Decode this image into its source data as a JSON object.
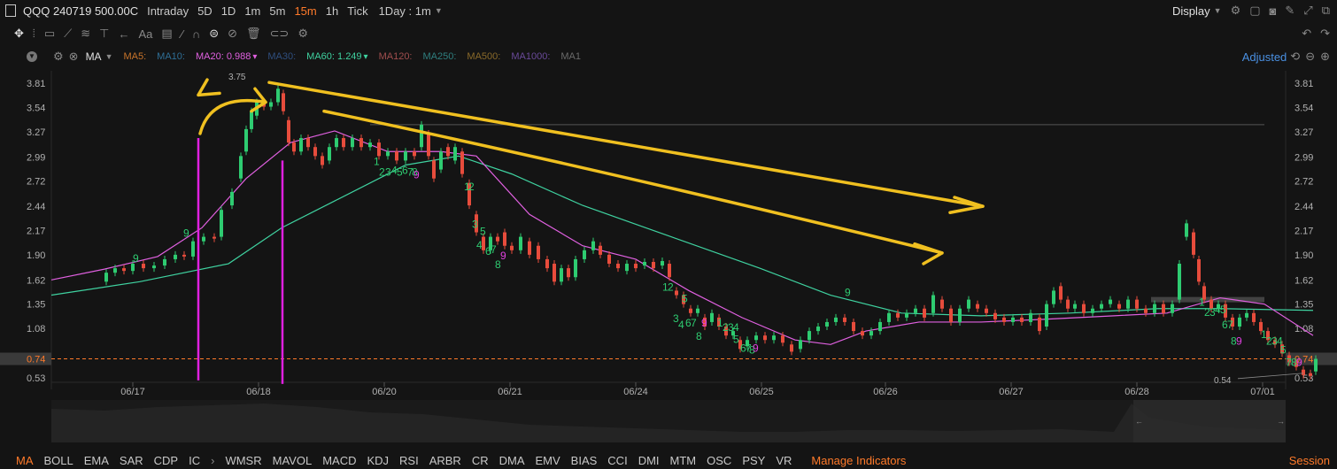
{
  "topbar": {
    "symbol": "QQQ 240719 500.00C",
    "intervals": [
      {
        "label": "Intraday",
        "active": false
      },
      {
        "label": "5D",
        "active": false
      },
      {
        "label": "1D",
        "active": false
      },
      {
        "label": "1m",
        "active": false
      },
      {
        "label": "5m",
        "active": false
      },
      {
        "label": "15m",
        "active": true
      },
      {
        "label": "1h",
        "active": false
      },
      {
        "label": "Tick",
        "active": false
      }
    ],
    "range_select": "1Day : 1m",
    "display_label": "Display"
  },
  "indicator_bar": {
    "type_label": "MA",
    "adjusted_label": "Adjusted",
    "items": [
      {
        "label": "MA5:",
        "color": "#c9742a"
      },
      {
        "label": "MA10:",
        "color": "#2f6f96"
      },
      {
        "label": "MA20: 0.988",
        "color": "#e060e0"
      },
      {
        "label": "MA30:",
        "color": "#2f4f7f"
      },
      {
        "label": "MA60: 1.249",
        "color": "#3fd2a0"
      },
      {
        "label": "MA120:",
        "color": "#a04e4e"
      },
      {
        "label": "MA250:",
        "color": "#2f7f7f"
      },
      {
        "label": "MA500:",
        "color": "#8a6a2a"
      },
      {
        "label": "MA1000:",
        "color": "#6a4a9a"
      },
      {
        "label": "MA1",
        "color": "#6a6a6a"
      }
    ]
  },
  "chart_data": {
    "type": "candlestick",
    "y_ticks": [
      "3.81",
      "3.54",
      "3.27",
      "2.99",
      "2.72",
      "2.44",
      "2.17",
      "1.90",
      "1.62",
      "1.35",
      "1.08",
      "0.74",
      "0.53"
    ],
    "ylim": [
      0.4,
      3.95
    ],
    "x_ticks": [
      "06/17",
      "06/18",
      "06/20",
      "06/21",
      "06/24",
      "06/25",
      "06/26",
      "06/27",
      "06/28",
      "07/01"
    ],
    "current_price": "0.74",
    "high_label": "3.75",
    "low_label": "0.54",
    "colors": {
      "up": "#2ecc71",
      "down": "#e74c3c",
      "ma20": "#e060e0",
      "ma60": "#3fd2a0",
      "price_line": "#ff7a2a",
      "annotation": "#f0c020",
      "vline": "#e020e0"
    },
    "ma20": [
      [
        0,
        1.62
      ],
      [
        60,
        1.74
      ],
      [
        120,
        1.88
      ],
      [
        170,
        2.2
      ],
      [
        220,
        2.75
      ],
      [
        270,
        3.15
      ],
      [
        320,
        3.28
      ],
      [
        380,
        3.05
      ],
      [
        440,
        3.05
      ],
      [
        480,
        3.0
      ],
      [
        540,
        2.35
      ],
      [
        600,
        2.0
      ],
      [
        660,
        1.85
      ],
      [
        720,
        1.5
      ],
      [
        780,
        1.2
      ],
      [
        840,
        0.95
      ],
      [
        880,
        0.9
      ],
      [
        920,
        1.05
      ],
      [
        980,
        1.15
      ],
      [
        1050,
        1.15
      ],
      [
        1120,
        1.18
      ],
      [
        1200,
        1.22
      ],
      [
        1260,
        1.25
      ],
      [
        1320,
        1.42
      ],
      [
        1370,
        1.35
      ],
      [
        1425,
        1.0
      ]
    ],
    "ma60": [
      [
        0,
        1.45
      ],
      [
        100,
        1.6
      ],
      [
        200,
        1.8
      ],
      [
        260,
        2.2
      ],
      [
        320,
        2.5
      ],
      [
        400,
        2.9
      ],
      [
        460,
        3.0
      ],
      [
        520,
        2.8
      ],
      [
        600,
        2.45
      ],
      [
        700,
        2.1
      ],
      [
        800,
        1.75
      ],
      [
        880,
        1.45
      ],
      [
        960,
        1.25
      ],
      [
        1050,
        1.22
      ],
      [
        1150,
        1.25
      ],
      [
        1250,
        1.3
      ],
      [
        1320,
        1.3
      ],
      [
        1425,
        1.28
      ]
    ],
    "candles": [
      [
        62,
        1.6,
        1.7
      ],
      [
        72,
        1.7,
        1.75
      ],
      [
        82,
        1.75,
        1.72
      ],
      [
        92,
        1.72,
        1.8
      ],
      [
        104,
        1.8,
        1.75
      ],
      [
        116,
        1.75,
        1.78
      ],
      [
        128,
        1.78,
        1.85
      ],
      [
        140,
        1.85,
        1.9
      ],
      [
        150,
        1.9,
        1.88
      ],
      [
        160,
        1.88,
        2.05
      ],
      [
        172,
        2.05,
        2.1
      ],
      [
        184,
        2.1,
        2.08
      ],
      [
        192,
        2.1,
        2.4
      ],
      [
        204,
        2.45,
        2.6
      ],
      [
        214,
        2.75,
        3.0
      ],
      [
        220,
        3.05,
        3.3
      ],
      [
        226,
        3.3,
        3.5
      ],
      [
        232,
        3.45,
        3.6
      ],
      [
        240,
        3.6,
        3.55
      ],
      [
        248,
        3.55,
        3.6
      ],
      [
        256,
        3.6,
        3.75
      ],
      [
        262,
        3.7,
        3.5
      ],
      [
        268,
        3.4,
        3.15
      ],
      [
        274,
        3.15,
        3.05
      ],
      [
        282,
        3.05,
        3.2
      ],
      [
        290,
        3.2,
        3.1
      ],
      [
        298,
        3.1,
        3.0
      ],
      [
        306,
        3.0,
        2.9
      ],
      [
        314,
        2.95,
        3.1
      ],
      [
        322,
        3.1,
        3.2
      ],
      [
        330,
        3.2,
        3.1
      ],
      [
        340,
        3.1,
        3.2
      ],
      [
        350,
        3.2,
        3.1
      ],
      [
        360,
        3.1,
        3.15
      ],
      [
        370,
        3.15,
        3.0
      ],
      [
        380,
        3.0,
        3.05
      ],
      [
        390,
        3.05,
        2.95
      ],
      [
        400,
        2.95,
        3.05
      ],
      [
        410,
        3.05,
        3.0
      ],
      [
        418,
        3.1,
        3.35
      ],
      [
        426,
        3.25,
        3.0
      ],
      [
        432,
        2.95,
        2.75
      ],
      [
        440,
        2.85,
        3.05
      ],
      [
        448,
        3.1,
        3.0
      ],
      [
        456,
        2.95,
        3.1
      ],
      [
        464,
        3.05,
        2.8
      ],
      [
        472,
        2.7,
        2.45
      ],
      [
        480,
        2.35,
        2.15
      ],
      [
        488,
        2.1,
        1.95
      ],
      [
        496,
        1.95,
        2.1
      ],
      [
        504,
        2.1,
        2.05
      ],
      [
        512,
        2.15,
        2.0
      ],
      [
        520,
        2.0,
        1.95
      ],
      [
        530,
        1.95,
        2.1
      ],
      [
        540,
        2.05,
        1.9
      ],
      [
        550,
        2.0,
        1.85
      ],
      [
        560,
        1.85,
        1.75
      ],
      [
        568,
        1.8,
        1.6
      ],
      [
        576,
        1.6,
        1.75
      ],
      [
        584,
        1.75,
        1.65
      ],
      [
        592,
        1.65,
        1.85
      ],
      [
        602,
        1.85,
        1.95
      ],
      [
        612,
        1.95,
        2.05
      ],
      [
        620,
        2.0,
        1.9
      ],
      [
        630,
        1.9,
        1.8
      ],
      [
        640,
        1.8,
        1.75
      ],
      [
        650,
        1.72,
        1.8
      ],
      [
        660,
        1.8,
        1.75
      ],
      [
        670,
        1.78,
        1.82
      ],
      [
        680,
        1.82,
        1.75
      ],
      [
        690,
        1.78,
        1.83
      ],
      [
        698,
        1.8,
        1.65
      ],
      [
        706,
        1.5,
        1.45
      ],
      [
        714,
        1.45,
        1.35
      ],
      [
        722,
        1.3,
        1.25
      ],
      [
        730,
        1.25,
        1.3
      ],
      [
        738,
        1.2,
        1.1
      ],
      [
        746,
        1.15,
        1.25
      ],
      [
        754,
        1.2,
        1.1
      ],
      [
        762,
        1.1,
        1.0
      ],
      [
        770,
        1.0,
        1.05
      ],
      [
        778,
        0.95,
        0.85
      ],
      [
        786,
        0.88,
        0.95
      ],
      [
        796,
        0.95,
        1.0
      ],
      [
        806,
        1.0,
        0.95
      ],
      [
        816,
        0.95,
        1.0
      ],
      [
        826,
        1.0,
        0.92
      ],
      [
        836,
        0.9,
        0.82
      ],
      [
        846,
        0.85,
        0.95
      ],
      [
        856,
        0.95,
        1.05
      ],
      [
        866,
        1.05,
        1.1
      ],
      [
        876,
        1.1,
        1.15
      ],
      [
        886,
        1.15,
        1.2
      ],
      [
        896,
        1.2,
        1.15
      ],
      [
        906,
        1.15,
        1.05
      ],
      [
        916,
        1.05,
        1.0
      ],
      [
        926,
        1.0,
        1.05
      ],
      [
        936,
        1.05,
        1.15
      ],
      [
        946,
        1.15,
        1.25
      ],
      [
        956,
        1.25,
        1.2
      ],
      [
        966,
        1.2,
        1.25
      ],
      [
        976,
        1.25,
        1.3
      ],
      [
        986,
        1.3,
        1.2
      ],
      [
        996,
        1.25,
        1.45
      ],
      [
        1006,
        1.4,
        1.3
      ],
      [
        1016,
        1.3,
        1.15
      ],
      [
        1026,
        1.15,
        1.3
      ],
      [
        1036,
        1.3,
        1.4
      ],
      [
        1046,
        1.35,
        1.3
      ],
      [
        1056,
        1.3,
        1.25
      ],
      [
        1066,
        1.25,
        1.18
      ],
      [
        1076,
        1.2,
        1.15
      ],
      [
        1086,
        1.15,
        1.2
      ],
      [
        1096,
        1.2,
        1.15
      ],
      [
        1106,
        1.15,
        1.25
      ],
      [
        1116,
        1.2,
        1.05
      ],
      [
        1124,
        1.1,
        1.35
      ],
      [
        1132,
        1.35,
        1.5
      ],
      [
        1140,
        1.55,
        1.4
      ],
      [
        1148,
        1.4,
        1.3
      ],
      [
        1156,
        1.3,
        1.35
      ],
      [
        1166,
        1.35,
        1.25
      ],
      [
        1176,
        1.25,
        1.3
      ],
      [
        1186,
        1.3,
        1.35
      ],
      [
        1196,
        1.35,
        1.4
      ],
      [
        1206,
        1.35,
        1.3
      ],
      [
        1216,
        1.3,
        1.4
      ],
      [
        1226,
        1.4,
        1.3
      ],
      [
        1236,
        1.3,
        1.25
      ],
      [
        1246,
        1.25,
        1.35
      ],
      [
        1256,
        1.35,
        1.25
      ],
      [
        1266,
        1.25,
        1.35
      ],
      [
        1274,
        1.4,
        1.8
      ],
      [
        1282,
        2.1,
        2.25
      ],
      [
        1290,
        2.15,
        1.9
      ],
      [
        1296,
        1.85,
        1.6
      ],
      [
        1302,
        1.55,
        1.4
      ],
      [
        1310,
        1.4,
        1.3
      ],
      [
        1318,
        1.3,
        1.35
      ],
      [
        1326,
        1.35,
        1.2
      ],
      [
        1334,
        1.2,
        1.1
      ],
      [
        1342,
        1.1,
        1.2
      ],
      [
        1350,
        1.2,
        1.25
      ],
      [
        1358,
        1.25,
        1.15
      ],
      [
        1366,
        1.15,
        1.05
      ],
      [
        1374,
        1.05,
        0.95
      ],
      [
        1382,
        0.95,
        0.9
      ],
      [
        1390,
        0.9,
        0.8
      ],
      [
        1398,
        0.78,
        0.7
      ],
      [
        1406,
        0.7,
        0.65
      ],
      [
        1414,
        0.62,
        0.56
      ],
      [
        1422,
        0.58,
        0.55
      ],
      [
        1428,
        0.6,
        0.74
      ]
    ],
    "seq_labels": [
      {
        "x": 92,
        "y": 1.82,
        "t": "9",
        "c": "#2ecc71"
      },
      {
        "x": 149,
        "y": 2.1,
        "t": "9",
        "c": "#2ecc71"
      },
      {
        "x": 364,
        "y": 2.9,
        "t": "1",
        "c": "#2ecc71"
      },
      {
        "x": 370,
        "y": 2.78,
        "t": "2",
        "c": "#2ecc71"
      },
      {
        "x": 377,
        "y": 2.78,
        "t": "3",
        "c": "#2ecc71"
      },
      {
        "x": 384,
        "y": 2.8,
        "t": "4",
        "c": "#2ecc71"
      },
      {
        "x": 390,
        "y": 2.78,
        "t": "5",
        "c": "#2ecc71"
      },
      {
        "x": 396,
        "y": 2.8,
        "t": "6",
        "c": "#2ecc71"
      },
      {
        "x": 402,
        "y": 2.78,
        "t": "7",
        "c": "#2ecc71"
      },
      {
        "x": 407,
        "y": 2.78,
        "t": "8",
        "c": "#2ecc71"
      },
      {
        "x": 409,
        "y": 2.75,
        "t": "9",
        "c": "#e040e0"
      },
      {
        "x": 466,
        "y": 2.62,
        "t": "1",
        "c": "#2ecc71"
      },
      {
        "x": 471,
        "y": 2.62,
        "t": "2",
        "c": "#2ecc71"
      },
      {
        "x": 475,
        "y": 2.2,
        "t": "3",
        "c": "#2ecc71"
      },
      {
        "x": 484,
        "y": 2.12,
        "t": "5",
        "c": "#2ecc71"
      },
      {
        "x": 480,
        "y": 1.97,
        "t": "4",
        "c": "#2ecc71"
      },
      {
        "x": 490,
        "y": 1.9,
        "t": "6",
        "c": "#2ecc71"
      },
      {
        "x": 496,
        "y": 1.92,
        "t": "7",
        "c": "#2ecc71"
      },
      {
        "x": 507,
        "y": 1.85,
        "t": "9",
        "c": "#e040e0"
      },
      {
        "x": 501,
        "y": 1.75,
        "t": "8",
        "c": "#2ecc71"
      },
      {
        "x": 690,
        "y": 1.5,
        "t": "1",
        "c": "#2ecc71"
      },
      {
        "x": 696,
        "y": 1.5,
        "t": "2",
        "c": "#2ecc71"
      },
      {
        "x": 712,
        "y": 1.37,
        "t": "5",
        "c": "#2ecc71"
      },
      {
        "x": 702,
        "y": 1.15,
        "t": "3",
        "c": "#2ecc71"
      },
      {
        "x": 708,
        "y": 1.08,
        "t": "4",
        "c": "#2ecc71"
      },
      {
        "x": 716,
        "y": 1.1,
        "t": "6",
        "c": "#2ecc71"
      },
      {
        "x": 722,
        "y": 1.1,
        "t": "7",
        "c": "#2ecc71"
      },
      {
        "x": 734,
        "y": 1.1,
        "t": "9",
        "c": "#e040e0"
      },
      {
        "x": 728,
        "y": 0.95,
        "t": "8",
        "c": "#2ecc71"
      },
      {
        "x": 752,
        "y": 1.1,
        "t": "1",
        "c": "#2ecc71"
      },
      {
        "x": 758,
        "y": 1.05,
        "t": "2",
        "c": "#2ecc71"
      },
      {
        "x": 764,
        "y": 1.05,
        "t": "3",
        "c": "#2ecc71"
      },
      {
        "x": 770,
        "y": 1.05,
        "t": "4",
        "c": "#2ecc71"
      },
      {
        "x": 770,
        "y": 0.92,
        "t": "5",
        "c": "#2ecc71"
      },
      {
        "x": 778,
        "y": 0.82,
        "t": "6",
        "c": "#2ecc71"
      },
      {
        "x": 784,
        "y": 0.82,
        "t": "7",
        "c": "#2ecc71"
      },
      {
        "x": 788,
        "y": 0.8,
        "t": "8",
        "c": "#2ecc71"
      },
      {
        "x": 792,
        "y": 0.82,
        "t": "9",
        "c": "#e040e0"
      },
      {
        "x": 896,
        "y": 1.44,
        "t": "9",
        "c": "#2ecc71"
      },
      {
        "x": 1296,
        "y": 1.33,
        "t": "1",
        "c": "#2ecc71"
      },
      {
        "x": 1302,
        "y": 1.22,
        "t": "2",
        "c": "#2ecc71"
      },
      {
        "x": 1308,
        "y": 1.22,
        "t": "3",
        "c": "#2ecc71"
      },
      {
        "x": 1314,
        "y": 1.25,
        "t": "4",
        "c": "#2ecc71"
      },
      {
        "x": 1320,
        "y": 1.25,
        "t": "5",
        "c": "#2ecc71"
      },
      {
        "x": 1322,
        "y": 1.08,
        "t": "6",
        "c": "#2ecc71"
      },
      {
        "x": 1328,
        "y": 1.08,
        "t": "7",
        "c": "#2ecc71"
      },
      {
        "x": 1332,
        "y": 0.9,
        "t": "8",
        "c": "#2ecc71"
      },
      {
        "x": 1338,
        "y": 0.9,
        "t": "9",
        "c": "#e040e0"
      },
      {
        "x": 1366,
        "y": 0.97,
        "t": "1",
        "c": "#2ecc71"
      },
      {
        "x": 1372,
        "y": 0.9,
        "t": "2",
        "c": "#2ecc71"
      },
      {
        "x": 1378,
        "y": 0.9,
        "t": "3",
        "c": "#2ecc71"
      },
      {
        "x": 1384,
        "y": 0.9,
        "t": "4",
        "c": "#2ecc71"
      },
      {
        "x": 1388,
        "y": 0.8,
        "t": "5",
        "c": "#2ecc71"
      },
      {
        "x": 1394,
        "y": 0.66,
        "t": "7",
        "c": "#2ecc71"
      },
      {
        "x": 1400,
        "y": 0.66,
        "t": "8",
        "c": "#2ecc71"
      },
      {
        "x": 1406,
        "y": 0.66,
        "t": "9",
        "c": "#e040e0"
      }
    ]
  },
  "bottom_indicators": [
    {
      "label": "MA",
      "active": true
    },
    {
      "label": "BOLL",
      "active": false
    },
    {
      "label": "EMA",
      "active": false
    },
    {
      "label": "SAR",
      "active": false
    },
    {
      "label": "CDP",
      "active": false
    },
    {
      "label": "IC",
      "active": false
    },
    {
      "label": "WMSR",
      "active": false
    },
    {
      "label": "MAVOL",
      "active": false
    },
    {
      "label": "MACD",
      "active": false
    },
    {
      "label": "KDJ",
      "active": false
    },
    {
      "label": "RSI",
      "active": false
    },
    {
      "label": "ARBR",
      "active": false
    },
    {
      "label": "CR",
      "active": false
    },
    {
      "label": "DMA",
      "active": false
    },
    {
      "label": "EMV",
      "active": false
    },
    {
      "label": "BIAS",
      "active": false
    },
    {
      "label": "CCI",
      "active": false
    },
    {
      "label": "DMI",
      "active": false
    },
    {
      "label": "MTM",
      "active": false
    },
    {
      "label": "OSC",
      "active": false
    },
    {
      "label": "PSY",
      "active": false
    },
    {
      "label": "VR",
      "active": false
    }
  ],
  "bottom_bar": {
    "manage_label": "Manage Indicators",
    "session_label": "Session"
  }
}
